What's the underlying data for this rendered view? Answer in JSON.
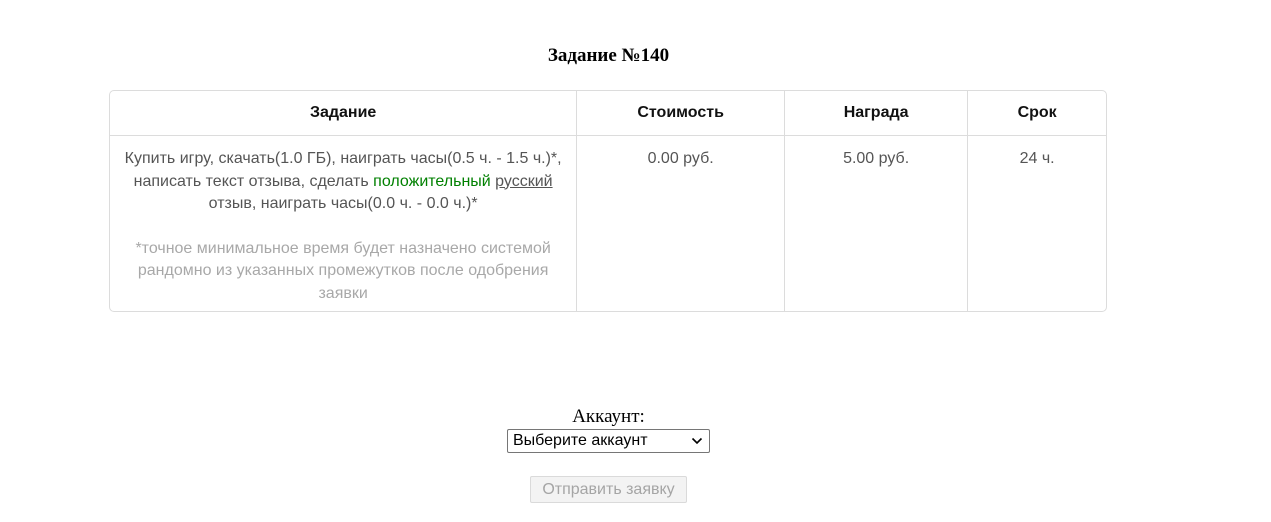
{
  "page": {
    "title": "Задание №140"
  },
  "table": {
    "headers": [
      "Задание",
      "Стоимость",
      "Награда",
      "Срок"
    ],
    "row": {
      "task_part1": "Купить игру, скачать(1.0 ГБ), наиграть часы(0.5 ч. - 1.5 ч.)*, написать текст отзыва, сделать ",
      "task_positive": "положительный",
      "task_space": " ",
      "task_russian": "русский",
      "task_part2": " отзыв, наиграть часы(0.0 ч. - 0.0 ч.)*",
      "task_note": "*точное минимальное время будет назначено системой рандомно из указанных промежутков после одобрения заявки",
      "cost": "0.00 руб.",
      "reward": "5.00 руб.",
      "term": "24 ч."
    }
  },
  "form": {
    "account_label": "Аккаунт:",
    "account_select_value": "Выберите аккаунт",
    "submit_label": "Отправить заявку"
  },
  "colors": {
    "positive": "#008000",
    "note": "#a8a8a8",
    "border": "#dcdcdc"
  },
  "icons": {
    "select_arrow": "chevron-down-icon"
  }
}
